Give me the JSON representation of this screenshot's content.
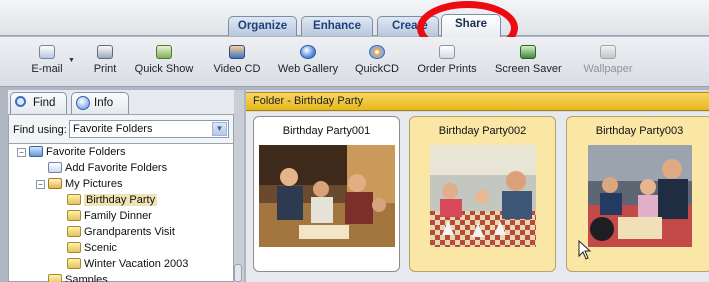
{
  "tabs": [
    {
      "label": "Organize",
      "active": false
    },
    {
      "label": "Enhance",
      "active": false
    },
    {
      "label": "Create",
      "active": false
    },
    {
      "label": "Share",
      "active": true
    }
  ],
  "toolbar": {
    "email": {
      "label": "E-mail",
      "icon": "envelope-icon"
    },
    "print": {
      "label": "Print",
      "icon": "printer-icon"
    },
    "quickshow": {
      "label": "Quick Show",
      "icon": "slideshow-icon"
    },
    "videocd": {
      "label": "Video CD",
      "icon": "videocd-icon"
    },
    "webgallery": {
      "label": "Web Gallery",
      "icon": "globe-icon"
    },
    "quickcd": {
      "label": "QuickCD",
      "icon": "cd-icon"
    },
    "orderprints": {
      "label": "Order Prints",
      "icon": "order-prints-icon"
    },
    "screensaver": {
      "label": "Screen Saver",
      "icon": "monitor-icon"
    },
    "wallpaper": {
      "label": "Wallpaper",
      "icon": "wallpaper-icon",
      "disabled": true
    }
  },
  "leftpanel": {
    "find_tab": "Find",
    "info_tab": "Info",
    "find_using_label": "Find using:",
    "find_using_value": "Favorite Folders",
    "tree": [
      {
        "label": "Favorite Folders",
        "level": 0,
        "expanded": true
      },
      {
        "label": "Add Favorite Folders",
        "level": 1
      },
      {
        "label": "My Pictures",
        "level": 1,
        "expanded": true
      },
      {
        "label": "Birthday Party",
        "level": 2,
        "selected": true
      },
      {
        "label": "Family Dinner",
        "level": 2
      },
      {
        "label": "Grandparents Visit",
        "level": 2
      },
      {
        "label": "Scenic",
        "level": 2
      },
      {
        "label": "Winter Vacation 2003",
        "level": 2
      },
      {
        "label": "Samples",
        "level": 1
      }
    ]
  },
  "content": {
    "folder_title": "Folder - Birthday Party",
    "photos": [
      {
        "caption": "Birthday Party001",
        "highlighted": false
      },
      {
        "caption": "Birthday Party002",
        "highlighted": true
      },
      {
        "caption": "Birthday Party003",
        "highlighted": true
      }
    ]
  },
  "colors": {
    "folder_bar": "#e7b91b",
    "highlight_card": "#fae7a6",
    "annotation_circle": "#ee0a12"
  }
}
